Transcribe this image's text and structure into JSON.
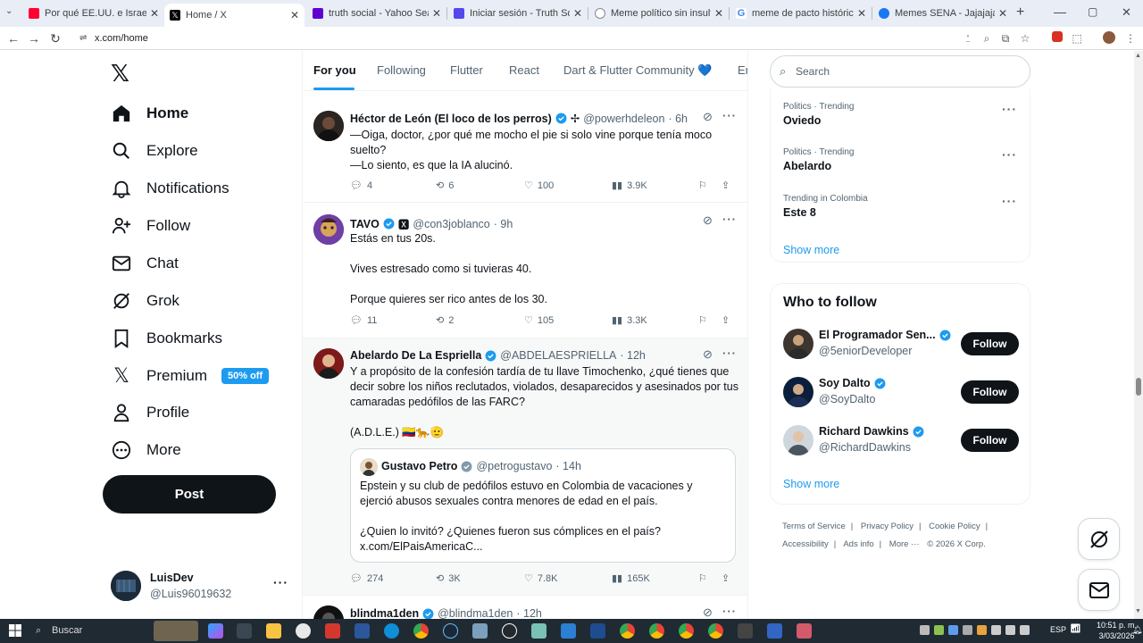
{
  "browser": {
    "tabs": [
      {
        "title": "Por qué EE.UU. e Israel atacaron",
        "fav": "#ff0033"
      },
      {
        "title": "Home / X",
        "fav": "#000000",
        "active": true
      },
      {
        "title": "truth social - Yahoo Search Tu",
        "fav": "#6001d2"
      },
      {
        "title": "Iniciar sesión - Truth Social",
        "fav": "#5448ee"
      },
      {
        "title": "Meme político sin insultos",
        "fav": "#888888"
      },
      {
        "title": "meme de pacto histórico - Bus",
        "fav": "#4285f4"
      },
      {
        "title": "Memes SENA - Jajajajaja Pact",
        "fav": "#1877f2"
      }
    ],
    "url": "x.com/home"
  },
  "nav": {
    "items": [
      {
        "label": "Home",
        "icon": "home-icon"
      },
      {
        "label": "Explore",
        "icon": "search-icon"
      },
      {
        "label": "Notifications",
        "icon": "bell-icon"
      },
      {
        "label": "Follow",
        "icon": "person-plus-icon"
      },
      {
        "label": "Chat",
        "icon": "mail-icon"
      },
      {
        "label": "Grok",
        "icon": "grok-icon"
      },
      {
        "label": "Bookmarks",
        "icon": "bookmark-icon"
      },
      {
        "label": "Premium",
        "icon": "x-icon"
      },
      {
        "label": "Profile",
        "icon": "person-icon"
      },
      {
        "label": "More",
        "icon": "more-circle-icon"
      }
    ],
    "premium_badge": "50% off",
    "post_label": "Post",
    "account": {
      "name": "LuisDev",
      "handle": "@Luis96019632"
    }
  },
  "feed_tabs": [
    "For you",
    "Following",
    "Flutter",
    "React",
    "Dart & Flutter Community 💙",
    "Er"
  ],
  "tweets": [
    {
      "name": "Héctor de León (El loco de los perros)",
      "suffix": "✢",
      "handle": "@powerhdeleon",
      "time": "· 6h",
      "text": "—Oiga, doctor, ¿por qué me mocho el pie si solo vine porque tenía moco suelto?\n—Lo siento, es que la IA alucinó.",
      "replies": "4",
      "reposts": "6",
      "likes": "100",
      "views": "3.9K"
    },
    {
      "name": "TAVO",
      "suffix": "🆇",
      "handle": "@con3joblanco",
      "time": "· 9h",
      "text": "Estás en tus 20s.\n\nVives estresado como si tuvieras 40.\n\nPorque quieres ser rico antes de los 30.",
      "replies": "11",
      "reposts": "2",
      "likes": "105",
      "views": "3.3K"
    },
    {
      "name": "Abelardo De La Espriella",
      "suffix": "",
      "handle": "@ABDELAESPRIELLA",
      "time": "· 12h",
      "text": "Y a propósito de la confesión tardía de tu llave Timochenko, ¿qué tienes que decir sobre los niños reclutados, violados, desaparecidos y asesinados por tus camaradas pedófilos de las  FARC?\n\n(A.D.L.E.) 🇨🇴🐆🫡",
      "quote": {
        "name": "Gustavo Petro",
        "handle": "@petrogustavo",
        "time": "· 14h",
        "text": "Epstein y su club de pedófilos estuvo en Colombia de vacaciones y ejerció abusos sexuales contra menores de edad en el país.\n\n¿Quien lo invitó? ¿Quienes fueron sus cómplices en el país? x.com/ElPaisAmericaC..."
      },
      "replies": "274",
      "reposts": "3K",
      "likes": "7.8K",
      "views": "165K"
    },
    {
      "name": "blindma1den",
      "suffix": "",
      "handle": "@blindma1den",
      "time": "· 12h"
    }
  ],
  "search": {
    "placeholder": "Search"
  },
  "trends": [
    {
      "context": "Politics · Trending",
      "name": "Oviedo"
    },
    {
      "context": "Politics · Trending",
      "name": "Abelardo"
    },
    {
      "context": "Trending in Colombia",
      "name": "Este 8"
    }
  ],
  "show_more": "Show more",
  "who_to_follow": {
    "title": "Who to follow",
    "users": [
      {
        "name": "El Programador Sen...",
        "handle": "@5eniorDeveloper"
      },
      {
        "name": "Soy Dalto",
        "handle": "@SoyDalto"
      },
      {
        "name": "Richard Dawkins",
        "handle": "@RichardDawkins"
      }
    ],
    "follow_label": "Follow"
  },
  "footer": {
    "links": [
      "Terms of Service",
      "Privacy Policy",
      "Cookie Policy",
      "Accessibility",
      "Ads info",
      "More ···"
    ],
    "copyright": "© 2026 X Corp."
  },
  "taskbar": {
    "search": "Buscar",
    "lang": "ESP",
    "time": "10:51 p. m.",
    "date": "3/03/2026"
  },
  "colors": {
    "accent": "#1d9bf0",
    "text": "#0f1419",
    "muted": "#536471"
  }
}
